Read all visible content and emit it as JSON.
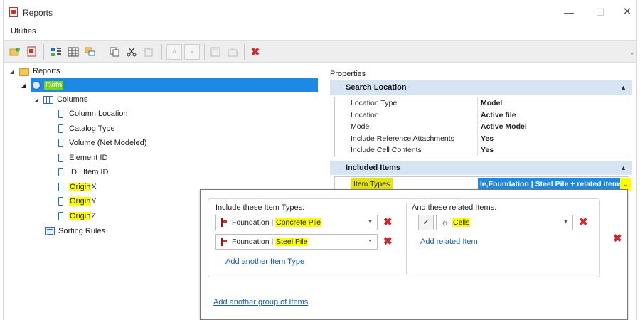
{
  "window": {
    "title": "Reports",
    "controls": {
      "minimize": "—",
      "maximize": "☐",
      "close": "✕"
    }
  },
  "menu": {
    "items": [
      "Utilities"
    ]
  },
  "toolbar": {
    "buttons": [
      "new-report-icon",
      "new-group-icon",
      "columns-icon",
      "grid-icon",
      "sorting-icon",
      "copy-icon",
      "cut-icon",
      "paste-icon",
      "move-up-icon",
      "move-down-icon",
      "save-icon",
      "import-icon",
      "delete-icon"
    ]
  },
  "tree": {
    "root": {
      "label": "Reports",
      "expander": "◢"
    },
    "data": {
      "label": "Data",
      "expander": "◢"
    },
    "columns": {
      "label": "Columns",
      "expander": "◢"
    },
    "column_items": [
      {
        "label": "Column Location"
      },
      {
        "label": "Catalog Type"
      },
      {
        "label": "Volume (Net Modeled)"
      },
      {
        "label": "Element ID"
      },
      {
        "label": "ID | Item ID"
      },
      {
        "highlight": "Origin",
        "suffix": "X"
      },
      {
        "highlight": "Origin",
        "suffix": "Y"
      },
      {
        "highlight": "Origin",
        "suffix": "Z"
      }
    ],
    "sorting": {
      "label": "Sorting Rules"
    }
  },
  "properties": {
    "label": "Properties",
    "search_location": {
      "header": "Search Location",
      "caret": "▲",
      "rows": [
        {
          "key": "Location Type",
          "value": "Model"
        },
        {
          "key": "Location",
          "value": "Active file"
        },
        {
          "key": "Model",
          "value": "Active Model"
        },
        {
          "key": "Include Reference Attachments",
          "value": "Yes"
        },
        {
          "key": "Include Cell Contents",
          "value": "Yes"
        }
      ]
    },
    "included_items": {
      "header": "Included Items",
      "caret": "▲",
      "item_types_key": "Item Types",
      "item_types_value": "le,Foundation | Steel Pile + related items",
      "dropdown_glyph": "⌄"
    }
  },
  "popup": {
    "include_label": "Include these Item Types:",
    "related_label": "And these related Items:",
    "item_types": [
      {
        "prefix": "Foundation | ",
        "highlight": "Concrete Pile"
      },
      {
        "prefix": "Foundation | ",
        "highlight": "Steel Pile"
      }
    ],
    "related_items": [
      {
        "check": "✓",
        "highlight": "Cells"
      }
    ],
    "add_item_type": "Add another Item Type",
    "add_related_item": "Add related Item",
    "add_group": "Add another group of Items",
    "delete_glyph": "✖",
    "combo_arrow": "▼"
  },
  "colors": {
    "selection": "#1e88e5",
    "highlight_yellow": "#ffff00",
    "highlight_green": "#7dd321",
    "section_header": "#d6e4f3",
    "delete_red": "#d0242b",
    "link": "#1a5fb4"
  }
}
